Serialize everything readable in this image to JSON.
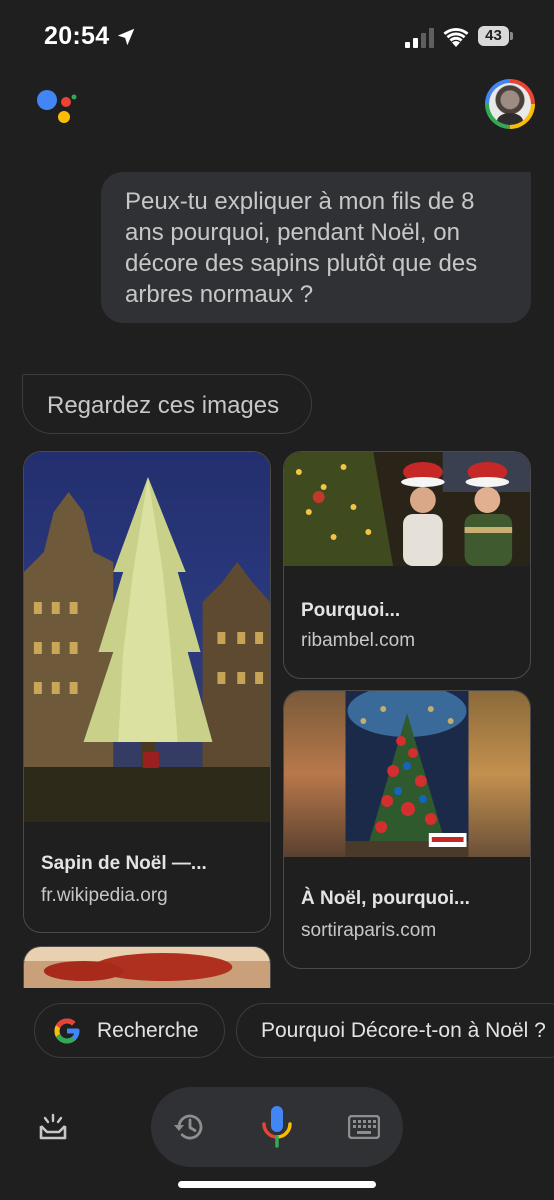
{
  "status_bar": {
    "time": "20:54",
    "battery": "43"
  },
  "icons": {
    "location": "location-arrow-icon",
    "signal": "cellular-signal-icon",
    "wifi": "wifi-icon",
    "battery": "battery-icon",
    "assistant": "google-assistant-logo",
    "snapshot": "snapshot-icon",
    "history": "history-icon",
    "mic": "microphone-icon",
    "keyboard": "keyboard-icon",
    "google": "google-g-icon"
  },
  "conversation": {
    "user_message": "Peux-tu expliquer à mon fils de 8 ans pourquoi, pendant Noël, on décore des sapins plutôt que des arbres normaux ?",
    "response_chip": "Regardez ces images"
  },
  "image_results": [
    {
      "title": "Sapin de Noël —...",
      "source": "fr.wikipedia.org"
    },
    {
      "title": "Pourquoi...",
      "source": "ribambel.com"
    },
    {
      "title": "À Noël, pourquoi...",
      "source": "sortiraparis.com"
    }
  ],
  "suggestions": {
    "search": "Recherche",
    "query": "Pourquoi Décore-t-on à Noël ?"
  },
  "colors": {
    "background": "#1f1f1f",
    "bubble": "#303134",
    "google_blue": "#4285f4",
    "google_red": "#ea4335",
    "google_yellow": "#fbbc04",
    "google_green": "#34a853"
  }
}
